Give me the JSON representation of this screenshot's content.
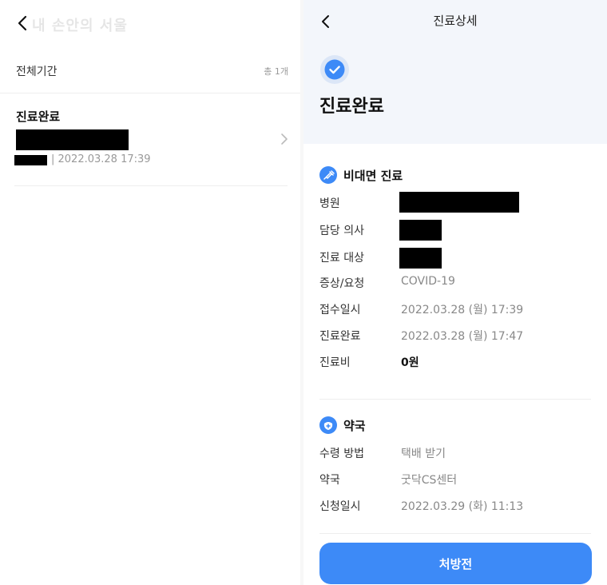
{
  "left": {
    "watermark": "내 손안의 서울",
    "period_label": "전체기간",
    "total_count": "총 1개",
    "items": [
      {
        "status": "진료완료",
        "date": "2022.03.28 17:39"
      }
    ]
  },
  "right": {
    "title": "진료상세",
    "status": "진료완료",
    "consult_section": {
      "title": "비대면 진료",
      "rows": [
        {
          "label": "병원",
          "value": ""
        },
        {
          "label": "담당 의사",
          "value": ""
        },
        {
          "label": "진료 대상",
          "value": ""
        },
        {
          "label": "증상/요청",
          "value": "COVID-19"
        },
        {
          "label": "접수일시",
          "value": "2022.03.28 (월) 17:39"
        },
        {
          "label": "진료완료",
          "value": "2022.03.28 (월) 17:47"
        },
        {
          "label": "진료비",
          "value": "0원"
        }
      ]
    },
    "pharmacy_section": {
      "title": "약국",
      "rows": [
        {
          "label": "수령 방법",
          "value": "택배 받기"
        },
        {
          "label": "약국",
          "value": "굿닥CS센터"
        },
        {
          "label": "신청일시",
          "value": "2022.03.29 (화) 11:13"
        }
      ]
    },
    "cta_label": "처방전"
  },
  "colors": {
    "accent": "#3d8af7",
    "header_bg": "#f3f6fb",
    "redaction": "#000000"
  },
  "icons": [
    "back-arrow-icon",
    "chevron-right-icon",
    "check-circle-icon",
    "syringe-icon",
    "pharmacy-icon"
  ]
}
